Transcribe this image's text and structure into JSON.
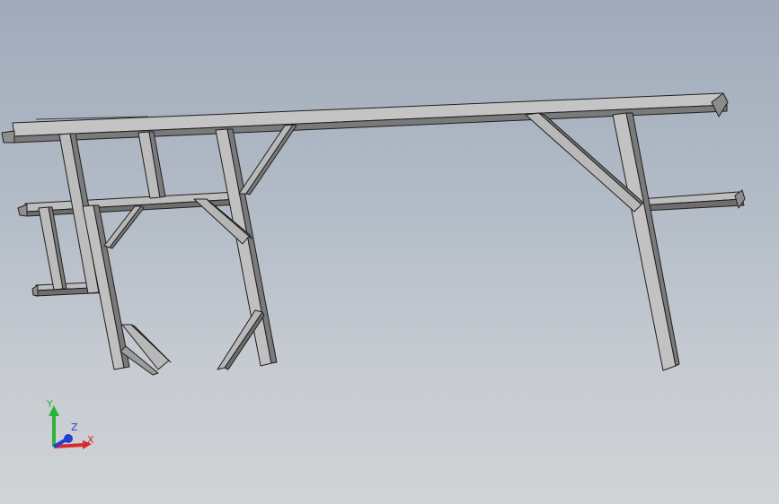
{
  "viewport": {
    "background_top": "#a0abba",
    "background_bottom": "#d0d3d6",
    "model_colors": {
      "face_light": "#c4c4c4",
      "face_mid": "#9c9c9c",
      "face_dark": "#6e6e6e",
      "edge": "#1e1e1e"
    }
  },
  "triad": {
    "x_label": "X",
    "y_label": "Y",
    "z_label": "Z",
    "x_color": "#d82a2a",
    "y_color": "#2bb33a",
    "z_color": "#2340d8"
  }
}
